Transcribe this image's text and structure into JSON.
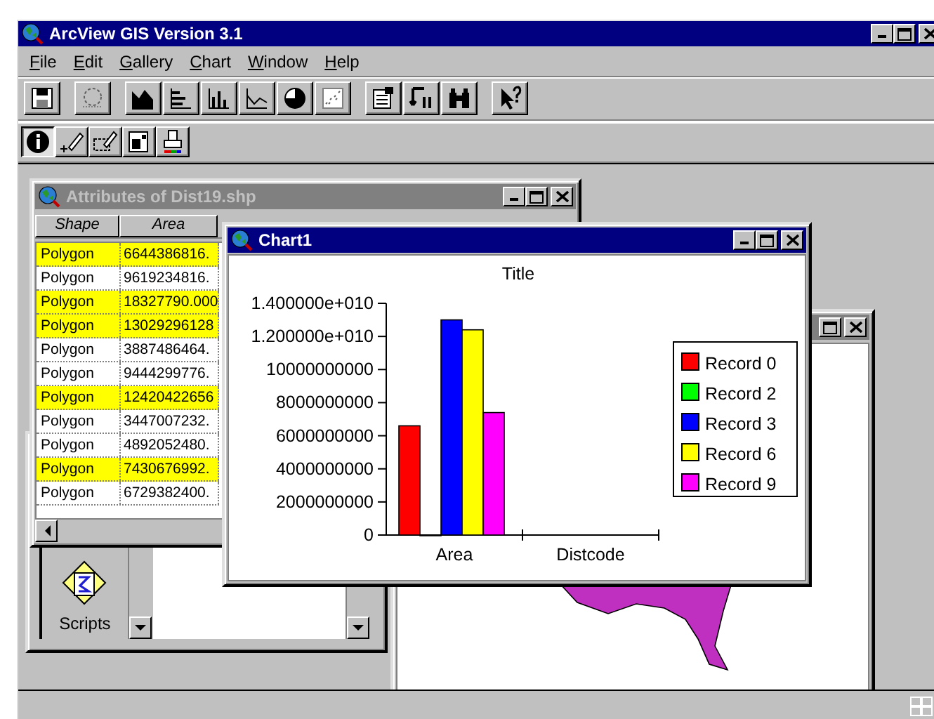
{
  "app": {
    "title": "ArcView GIS Version 3.1",
    "menus": [
      "File",
      "Edit",
      "Gallery",
      "Chart",
      "Window",
      "Help"
    ]
  },
  "tools": [
    {
      "selected": true
    },
    {
      "selected": false
    },
    {
      "selected": false
    },
    {
      "selected": false
    },
    {
      "selected": false
    }
  ],
  "attributes_window": {
    "title": "Attributes of Dist19.shp",
    "columns": [
      "Shape",
      "Area"
    ],
    "rows": [
      {
        "shape": "Polygon",
        "area": "6644386816.",
        "selected": true
      },
      {
        "shape": "Polygon",
        "area": "9619234816.",
        "selected": false
      },
      {
        "shape": "Polygon",
        "area": "18327790.000",
        "selected": true
      },
      {
        "shape": "Polygon",
        "area": "13029296128",
        "selected": true
      },
      {
        "shape": "Polygon",
        "area": "3887486464.",
        "selected": false
      },
      {
        "shape": "Polygon",
        "area": "9444299776.",
        "selected": false
      },
      {
        "shape": "Polygon",
        "area": "12420422656",
        "selected": true
      },
      {
        "shape": "Polygon",
        "area": "3447007232.",
        "selected": false
      },
      {
        "shape": "Polygon",
        "area": "4892052480.",
        "selected": false
      },
      {
        "shape": "Polygon",
        "area": "7430676992.",
        "selected": true
      },
      {
        "shape": "Polygon",
        "area": "6729382400.",
        "selected": false
      }
    ]
  },
  "project_window": {
    "items": [
      "Scripts"
    ]
  },
  "chart_window": {
    "title": "Chart1",
    "chart_data": {
      "type": "bar",
      "title": "Title",
      "categories": [
        "Area",
        "Distcode"
      ],
      "series": [
        {
          "name": "Record 0",
          "color": "#ff0000",
          "values": [
            6600000000,
            null
          ]
        },
        {
          "name": "Record 2",
          "color": "#00ff00",
          "values": [
            0,
            null
          ]
        },
        {
          "name": "Record 3",
          "color": "#0000ff",
          "values": [
            13000000000,
            null
          ]
        },
        {
          "name": "Record 6",
          "color": "#ffff00",
          "values": [
            12400000000,
            null
          ]
        },
        {
          "name": "Record 9",
          "color": "#ff00ff",
          "values": [
            7400000000,
            null
          ]
        }
      ],
      "legend": true,
      "ylim": [
        0,
        14000000000
      ],
      "yticks": [
        {
          "value": 0,
          "label": "0"
        },
        {
          "value": 2000000000,
          "label": "2000000000"
        },
        {
          "value": 4000000000,
          "label": "4000000000"
        },
        {
          "value": 6000000000,
          "label": "6000000000"
        },
        {
          "value": 8000000000,
          "label": "8000000000"
        },
        {
          "value": 10000000000,
          "label": "10000000000"
        },
        {
          "value": 12000000000,
          "label": "1.200000e+010"
        },
        {
          "value": 14000000000,
          "label": "1.400000e+010"
        }
      ]
    }
  }
}
